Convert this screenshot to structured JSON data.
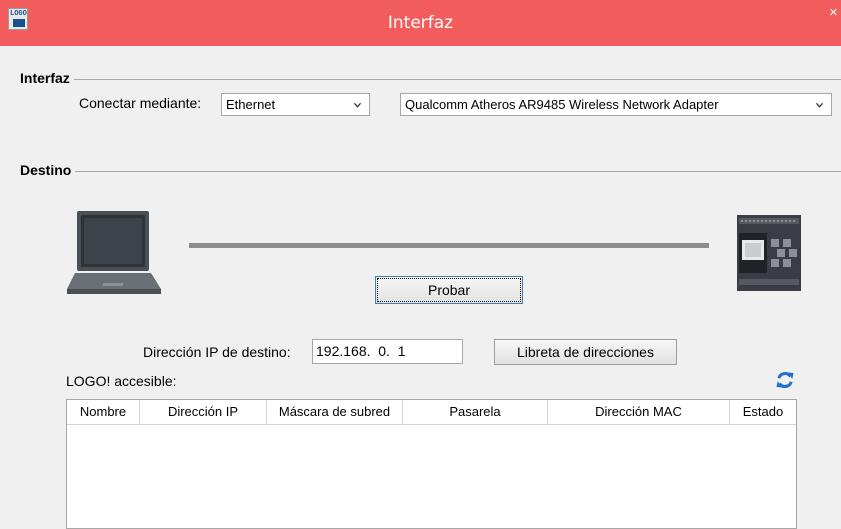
{
  "window": {
    "title": "Interfaz",
    "app_icon_text": "LOGO",
    "close_glyph": "×"
  },
  "interface_group": {
    "title": "Interfaz",
    "connect_label": "Conectar mediante:",
    "connect_value": "Ethernet",
    "adapter_value": "Qualcomm Atheros AR9485 Wireless Network Adapter"
  },
  "destination_group": {
    "title": "Destino",
    "test_button": "Probar",
    "ip_label": "Dirección IP de destino:",
    "ip_value": "192.168.  0.  1",
    "address_book_button": "Libreta de direcciones"
  },
  "accessible": {
    "label": "LOGO! accesible:",
    "columns": [
      "Nombre",
      "Dirección IP",
      "Máscara de subred",
      "Pasarela",
      "Dirección MAC",
      "Estado"
    ],
    "rows": []
  },
  "icons": {
    "app": "logo-app-icon",
    "laptop": "laptop-icon",
    "plc": "logo-plc-device-icon",
    "refresh": "refresh-icon",
    "dropdown": "chevron-down-icon"
  },
  "colors": {
    "titlebar": "#f25c5c",
    "refresh": "#1e6fd0"
  }
}
